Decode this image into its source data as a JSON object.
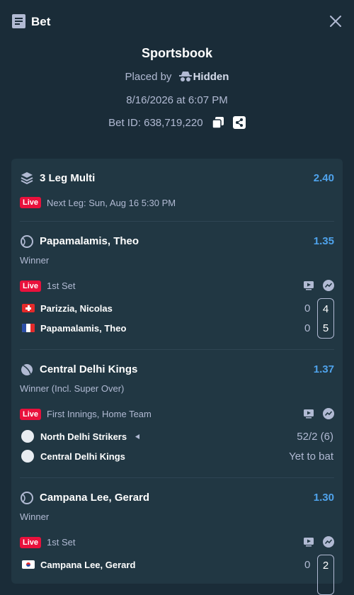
{
  "topbar": {
    "title": "Bet"
  },
  "header": {
    "book": "Sportsbook",
    "placed_prefix": "Placed by",
    "placed_user": "Hidden",
    "date": "8/16/2026 at 6:07 PM",
    "bet_id": "Bet ID: 638,719,220"
  },
  "multi": {
    "title": "3 Leg Multi",
    "odds": "2.40",
    "live_label": "Live",
    "next_leg": "Next Leg: Sun, Aug 16 5:30 PM"
  },
  "legs": [
    {
      "title": "Papamalamis, Theo",
      "odds": "1.35",
      "market": "Winner",
      "live_label": "Live",
      "status": "1st Set",
      "team1": "Parizzia, Nicolas",
      "team1_score": "0",
      "team1_set": "4",
      "team2": "Papamalamis, Theo",
      "team2_score": "0",
      "team2_set": "5"
    },
    {
      "title": "Central Delhi Kings",
      "odds": "1.37",
      "market": "Winner (Incl. Super Over)",
      "live_label": "Live",
      "status": "First Innings, Home Team",
      "team1": "North Delhi Strikers",
      "team1_score": "52/2 (6)",
      "team2": "Central Delhi Kings",
      "team2_score": "Yet to bat"
    },
    {
      "title": "Campana Lee, Gerard",
      "odds": "1.30",
      "market": "Winner",
      "live_label": "Live",
      "status": "1st Set",
      "team1": "Campana Lee, Gerard",
      "team1_score": "0",
      "team1_set": "2"
    }
  ],
  "colors": {
    "background": "#1a2c38",
    "card": "#213743",
    "accent": "#4fa3ec",
    "live": "#e9113c",
    "muted": "#b1bad3"
  }
}
